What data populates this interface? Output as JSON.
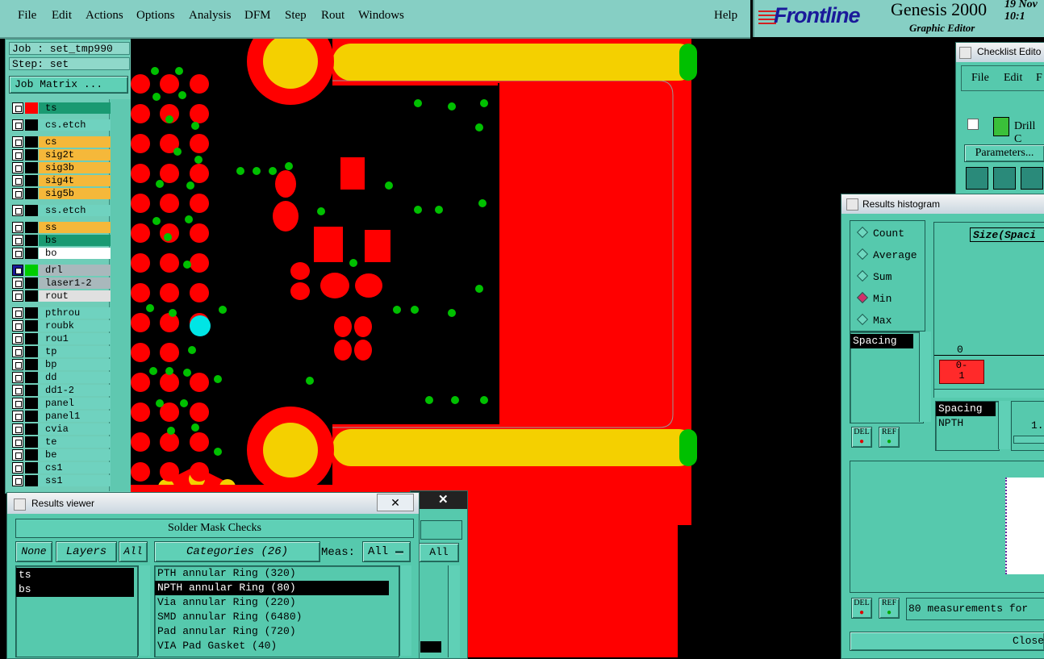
{
  "menubar": {
    "items": [
      "File",
      "Edit",
      "Actions",
      "Options",
      "Analysis",
      "DFM",
      "Step",
      "Rout",
      "Windows"
    ],
    "help": "Help"
  },
  "brand": {
    "logo": "Frontline",
    "product": "Genesis 2000",
    "subtitle": "Graphic Editor",
    "date": "19 Nov",
    "time": "10:1"
  },
  "job": {
    "job_line": "Job : set_tmp990",
    "step_line": "Step: set",
    "matrix_button": "Job Matrix ..."
  },
  "layers": [
    {
      "name": "ts",
      "swatch": "#ff0000",
      "bg": "#1a9a72"
    },
    {
      "name": "cs.etch",
      "swatch": "#000000",
      "bg": "#6fd2bf"
    },
    {
      "name": "cs",
      "swatch": "#000000",
      "bg": "#f5b83a"
    },
    {
      "name": "sig2t",
      "swatch": "#000000",
      "bg": "#f5b83a"
    },
    {
      "name": "sig3b",
      "swatch": "#000000",
      "bg": "#f5b83a"
    },
    {
      "name": "sig4t",
      "swatch": "#000000",
      "bg": "#f5b83a"
    },
    {
      "name": "sig5b",
      "swatch": "#000000",
      "bg": "#f5b83a"
    },
    {
      "name": "ss.etch",
      "swatch": "#000000",
      "bg": "#6fd2bf"
    },
    {
      "name": "ss",
      "swatch": "#000000",
      "bg": "#f5b83a"
    },
    {
      "name": "bs",
      "swatch": "#000000",
      "bg": "#1a9a72"
    },
    {
      "name": "bo",
      "swatch": "#000000",
      "bg": "#ffffff"
    },
    {
      "name": "drl",
      "swatch": "#00cc00",
      "bg": "#a9b8bc"
    },
    {
      "name": "laser1-2",
      "swatch": "#000000",
      "bg": "#a9b8bc"
    },
    {
      "name": "rout",
      "swatch": "#000000",
      "bg": "#e0e0e0"
    },
    {
      "name": "pthrou",
      "swatch": "#000000",
      "bg": "#6fd2bf"
    },
    {
      "name": "roubk",
      "swatch": "#000000",
      "bg": "#6fd2bf"
    },
    {
      "name": "rou1",
      "swatch": "#000000",
      "bg": "#6fd2bf"
    },
    {
      "name": "tp",
      "swatch": "#000000",
      "bg": "#6fd2bf"
    },
    {
      "name": "bp",
      "swatch": "#000000",
      "bg": "#6fd2bf"
    },
    {
      "name": "dd",
      "swatch": "#000000",
      "bg": "#6fd2bf"
    },
    {
      "name": "dd1-2",
      "swatch": "#000000",
      "bg": "#6fd2bf"
    },
    {
      "name": "panel",
      "swatch": "#000000",
      "bg": "#6fd2bf"
    },
    {
      "name": "panel1",
      "swatch": "#000000",
      "bg": "#6fd2bf"
    },
    {
      "name": "cvia",
      "swatch": "#000000",
      "bg": "#6fd2bf"
    },
    {
      "name": "te",
      "swatch": "#000000",
      "bg": "#6fd2bf"
    },
    {
      "name": "be",
      "swatch": "#000000",
      "bg": "#6fd2bf"
    },
    {
      "name": "cs1",
      "swatch": "#000000",
      "bg": "#6fd2bf"
    },
    {
      "name": "ss1",
      "swatch": "#000000",
      "bg": "#6fd2bf"
    }
  ],
  "results_viewer": {
    "title": "Results viewer",
    "header": "Solder Mask Checks",
    "none_btn": "None",
    "layers_btn": "Layers",
    "all_btn": "All",
    "categories_btn": "Categories (26)",
    "meas_label": "Meas:",
    "meas_value": "All",
    "meas_value2": "All",
    "layers_list": [
      "ts",
      "bs"
    ],
    "categories_list": [
      "PTH annular Ring (320)",
      "NPTH annular Ring (80)",
      "Via annular Ring (220)",
      "SMD annular Ring (6480)",
      "Pad annular Ring (720)",
      "VIA Pad Gasket (40)"
    ],
    "selected_category": "NPTH annular Ring (80)"
  },
  "checklist_editor": {
    "title": "Checklist Edito",
    "menu": [
      "File",
      "Edit",
      "F"
    ],
    "drill_label": "Drill C",
    "params_btn": "Parameters..."
  },
  "histogram": {
    "title": "Results histogram",
    "modes": [
      "Count",
      "Average",
      "Sum",
      "Min",
      "Max"
    ],
    "selected_mode": "Min",
    "list_items": [
      "Spacing"
    ],
    "size_label": "Size(Spaci",
    "zero_label": "0",
    "bin_label": "0-\n1",
    "spacing_label": "Spacing",
    "npth_label": "NPTH",
    "value_label": "1.",
    "del_btn": "DEL",
    "ref_btn": "REF",
    "measurements_text": "80 measurements for",
    "close_btn": "Close"
  },
  "colors": {
    "red": "#ff0000",
    "yellow": "#f4d000",
    "green": "#00c000",
    "cyan": "#00e5e5",
    "panel_teal": "#56c9ad"
  }
}
